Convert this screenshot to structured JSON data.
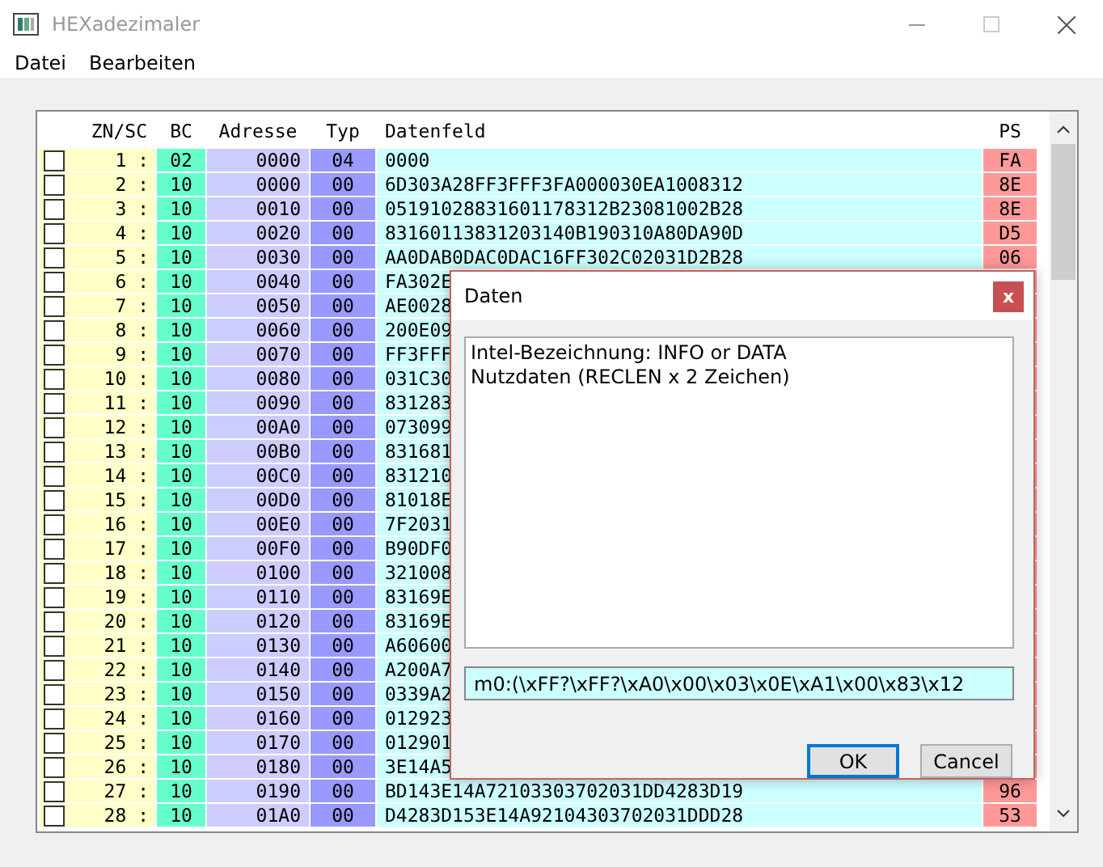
{
  "window": {
    "title": "HEXadezimaler"
  },
  "menu": [
    "Datei",
    "Bearbeiten"
  ],
  "table": {
    "columns": [
      "ZN/SC",
      "BC",
      "Adresse",
      "Typ",
      "Datenfeld",
      "PS"
    ],
    "rows": [
      {
        "checked": false,
        "zn": "1 :",
        "bc": "02",
        "address": "0000",
        "type": "04",
        "data": "0000",
        "ps": "FA"
      },
      {
        "checked": false,
        "zn": "2 :",
        "bc": "10",
        "address": "0000",
        "type": "00",
        "data": "6D303A28FF3FFF3FA000030EA1008312",
        "ps": "8E"
      },
      {
        "checked": false,
        "zn": "3 :",
        "bc": "10",
        "address": "0010",
        "type": "00",
        "data": "05191028831601178312B23081002B28",
        "ps": "8E"
      },
      {
        "checked": false,
        "zn": "4 :",
        "bc": "10",
        "address": "0020",
        "type": "00",
        "data": "83160113831203140B190310A80DA90D",
        "ps": "D5"
      },
      {
        "checked": false,
        "zn": "5 :",
        "bc": "10",
        "address": "0030",
        "type": "00",
        "data": "AA0DAB0DAC0DAC16FF302C02031D2B28",
        "ps": "06"
      },
      {
        "checked": false,
        "zn": "6 :",
        "bc": "10",
        "address": "0040",
        "type": "00",
        "data": "FA302E"
      },
      {
        "checked": false,
        "zn": "7 :",
        "bc": "10",
        "address": "0050",
        "type": "00",
        "data": "AE0028"
      },
      {
        "checked": false,
        "zn": "8 :",
        "bc": "10",
        "address": "0060",
        "type": "00",
        "data": "200E09"
      },
      {
        "checked": false,
        "zn": "9 :",
        "bc": "10",
        "address": "0070",
        "type": "00",
        "data": "FF3FFF"
      },
      {
        "checked": false,
        "zn": "10 :",
        "bc": "10",
        "address": "0080",
        "type": "00",
        "data": "031C30"
      },
      {
        "checked": false,
        "zn": "11 :",
        "bc": "10",
        "address": "0090",
        "type": "00",
        "data": "831283"
      },
      {
        "checked": false,
        "zn": "12 :",
        "bc": "10",
        "address": "00A0",
        "type": "00",
        "data": "073099"
      },
      {
        "checked": false,
        "zn": "13 :",
        "bc": "10",
        "address": "00B0",
        "type": "00",
        "data": "831681"
      },
      {
        "checked": false,
        "zn": "14 :",
        "bc": "10",
        "address": "00C0",
        "type": "00",
        "data": "831210"
      },
      {
        "checked": false,
        "zn": "15 :",
        "bc": "10",
        "address": "00D0",
        "type": "00",
        "data": "81018E"
      },
      {
        "checked": false,
        "zn": "16 :",
        "bc": "10",
        "address": "00E0",
        "type": "00",
        "data": "7F2031"
      },
      {
        "checked": false,
        "zn": "17 :",
        "bc": "10",
        "address": "00F0",
        "type": "00",
        "data": "B90DF0"
      },
      {
        "checked": false,
        "zn": "18 :",
        "bc": "10",
        "address": "0100",
        "type": "00",
        "data": "321008"
      },
      {
        "checked": false,
        "zn": "19 :",
        "bc": "10",
        "address": "0110",
        "type": "00",
        "data": "83169E"
      },
      {
        "checked": false,
        "zn": "20 :",
        "bc": "10",
        "address": "0120",
        "type": "00",
        "data": "83169E"
      },
      {
        "checked": false,
        "zn": "21 :",
        "bc": "10",
        "address": "0130",
        "type": "00",
        "data": "A60600"
      },
      {
        "checked": false,
        "zn": "22 :",
        "bc": "10",
        "address": "0140",
        "type": "00",
        "data": "A200A7"
      },
      {
        "checked": false,
        "zn": "23 :",
        "bc": "10",
        "address": "0150",
        "type": "00",
        "data": "0339A2"
      },
      {
        "checked": false,
        "zn": "24 :",
        "bc": "10",
        "address": "0160",
        "type": "00",
        "data": "012923"
      },
      {
        "checked": false,
        "zn": "25 :",
        "bc": "10",
        "address": "0170",
        "type": "00",
        "data": "012901"
      },
      {
        "checked": false,
        "zn": "26 :",
        "bc": "10",
        "address": "0180",
        "type": "00",
        "data": "3E14A5"
      },
      {
        "checked": false,
        "zn": "27 :",
        "bc": "10",
        "address": "0190",
        "type": "00",
        "data": "BD143E14A72103303702031DD4283D19",
        "ps": "96"
      },
      {
        "checked": false,
        "zn": "28 :",
        "bc": "10",
        "address": "01A0",
        "type": "00",
        "data": "D4283D153E14A92104303702031DDD28",
        "ps": "53"
      }
    ]
  },
  "dialog": {
    "title": "Daten",
    "close": "x",
    "lines": [
      "Intel-Bezeichnung: INFO or DATA",
      "Nutzdaten (RECLEN x 2 Zeichen)"
    ],
    "value": "m0:(\\xFF?\\xFF?\\xA0\\x00\\x03\\x0E\\xA1\\x00\\x83\\x12",
    "buttons": [
      {
        "label": "OK",
        "selected": true
      },
      {
        "label": "Cancel",
        "selected": false
      }
    ]
  }
}
